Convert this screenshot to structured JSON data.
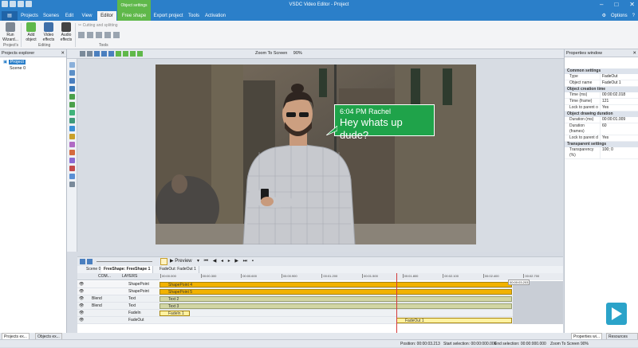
{
  "window": {
    "title": "VSDC Video Editor - Project",
    "context_tab": "Object settings"
  },
  "menu": {
    "items": [
      "Projects",
      "Scenes",
      "Edit",
      "View",
      "Editor",
      "Free shape",
      "Export project",
      "Tools",
      "Activation"
    ],
    "active": "Editor",
    "options_label": "Options"
  },
  "ribbon": {
    "run_wizard": "Run\nWizard...",
    "add_object": "Add\nobject",
    "video_effects": "Video\neffects",
    "audio_effects": "Audio\neffects",
    "cutting_splitting": "Cutting and splitting",
    "group_project": "Project's",
    "group_editing": "Editing",
    "group_tools": "Tools"
  },
  "toolbar": {
    "zoom_label": "Zoom To Screen",
    "zoom_value": "90%"
  },
  "projects_explorer": {
    "title": "Projects explorer",
    "project": "Project",
    "scene": "Scene 0"
  },
  "chat_bubble": {
    "time_name": "6:04 PM Rachel",
    "message": "Hey whats up dude?",
    "bg": "#1fa34a"
  },
  "properties": {
    "title": "Properties window",
    "common_settings": "Common settings",
    "type_key": "Type",
    "type_val": "FadeOut",
    "name_key": "Object name",
    "name_val": "FadeOut 1",
    "creation_time": "Object creation time",
    "time_ms_key": "Time (ms)",
    "time_ms_val": "00:00:02.018",
    "time_frame_key": "Time (frame)",
    "time_frame_val": "121",
    "lock_key": "Lock to parent o",
    "lock_val": "Yes",
    "drawing_duration": "Object drawing duration",
    "dur_ms_key": "Duration (ms)",
    "dur_ms_val": "00:00:01.009",
    "dur_frames_key": "Duration (frames)",
    "dur_frames_val": "60",
    "lock2_key": "Lock to parent d",
    "lock2_val": "Yes",
    "transparent": "Transparent settings",
    "trans_key": "Transparency (%)",
    "trans_val": "100; 0"
  },
  "timeline": {
    "preview_label": "Preview",
    "tabs": [
      "Scene 0",
      "FreeShape: FreeShape 1",
      "FadeOut: FadeOut 1"
    ],
    "col_composition": "COM...",
    "col_layers": "LAYERS",
    "ruler": [
      "00:00.000",
      "00:00.100",
      "00:00.200",
      "00:00.300",
      "00:00.400",
      "00:00.500",
      "00:00.600",
      "00:00.700",
      "00:00.800",
      "00:00.900",
      "00:01.000",
      "00:01.100",
      "00:01.200",
      "00:01.300",
      "00:01.400",
      "00:01.500",
      "00:01.600",
      "00:01.700",
      "00:01.800",
      "00:01.900",
      "00:02.000",
      "00:02.100",
      "00:02.200",
      "00:02.300",
      "00:02.400",
      "00:02.500",
      "00:02.600",
      "00:02.700",
      "00:02.800",
      "00:02.900",
      "00:03.000"
    ],
    "marker": "00:00:03.203",
    "rows": [
      {
        "blend": "",
        "layer": "ShapePoint",
        "clip": "ShapePoint 4"
      },
      {
        "blend": "",
        "layer": "ShapePoint",
        "clip": "ShapePoint 5"
      },
      {
        "blend": "Blend",
        "layer": "Text",
        "clip": "Text 2"
      },
      {
        "blend": "Blend",
        "layer": "Text",
        "clip": "Text 3"
      },
      {
        "blend": "",
        "layer": "FadeIn",
        "clip": "FadeIn 1"
      },
      {
        "blend": "",
        "layer": "FadeOut",
        "clip": "FadeOut 1"
      }
    ]
  },
  "bottom_tabs": [
    "Projects ex...",
    "Objects ex...",
    "Properties wi...",
    "Resources wi..."
  ],
  "status": {
    "position_key": "Position:",
    "position_val": "00:00:03.213",
    "start_key": "Start selection:",
    "start_val": "00:00:000.000",
    "end_key": "End selection:",
    "end_val": "00:00:000.000",
    "zoom": "Zoom To Screen",
    "zoom_val": "90%"
  }
}
